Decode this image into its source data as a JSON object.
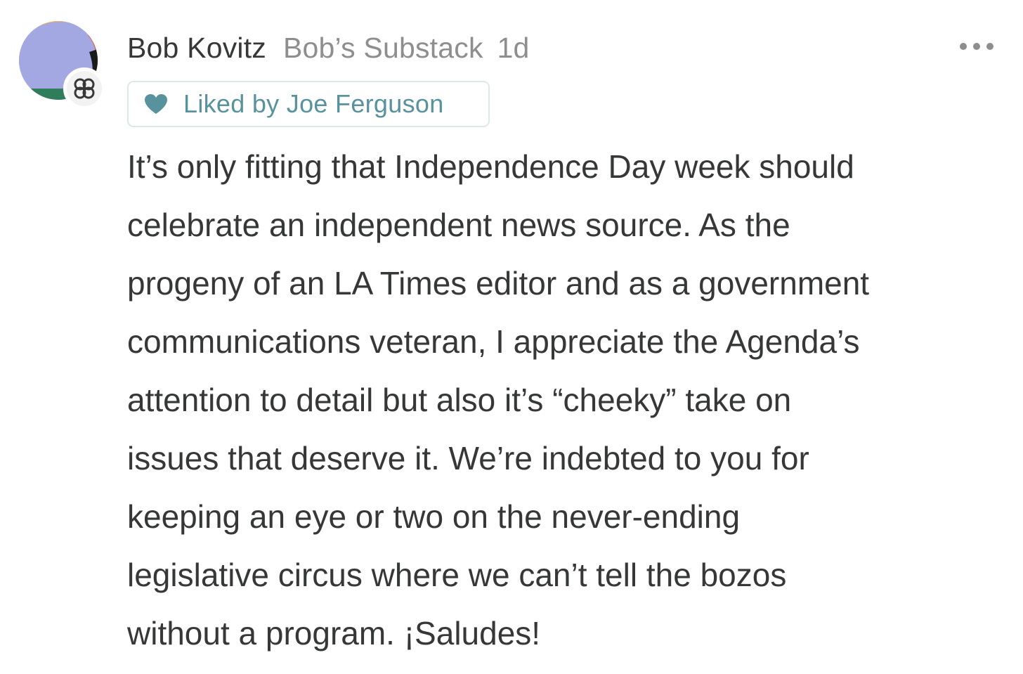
{
  "note": {
    "author": "Bob Kovitz",
    "publication": "Bob’s Substack",
    "timestamp": "1d",
    "liked_by": "Liked by Joe Ferguson",
    "body_lines": [
      "It’s only fitting that Independence Day week should",
      "celebrate an independent news source. As the",
      "progeny of an LA Times editor and as a government",
      "communications veteran, I appreciate the Agenda’s",
      "attention to detail but also it’s “cheeky” take on",
      "issues that deserve it. We’re indebted to you for",
      "keeping an eye or two on the never-ending",
      "legislative circus where we can’t tell the bozos",
      "without a program. ¡Saludes!"
    ]
  },
  "icons": {
    "more": "more-horizontal-icon",
    "heart": "heart-icon",
    "badge": "substack-notes-badge-icon"
  },
  "colors": {
    "text": "#363737",
    "muted": "#8e8e8e",
    "accent": "#58929c",
    "like_border": "#dde8ea",
    "avatar_fill": "#a3a8e3"
  }
}
